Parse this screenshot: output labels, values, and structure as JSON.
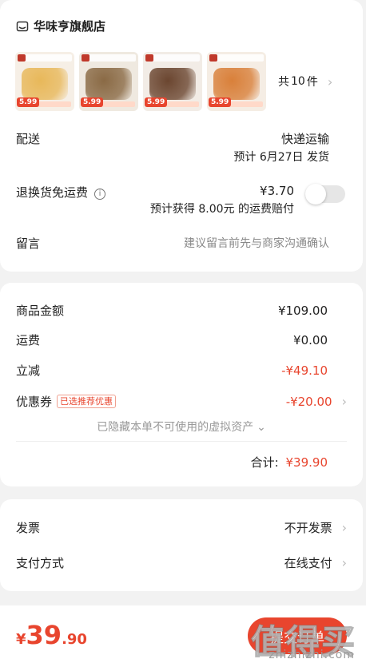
{
  "store": {
    "icon": "store-icon",
    "name": "华味亨旗舰店"
  },
  "items": {
    "thumbs": [
      {
        "price": "5.99",
        "color": "#e8b85a",
        "bg": "#f6efe6"
      },
      {
        "price": "5.99",
        "color": "#8a6a45",
        "bg": "#efe9e0"
      },
      {
        "price": "5.99",
        "color": "#6b4630",
        "bg": "#f2ece6"
      },
      {
        "price": "5.99",
        "color": "#d9803a",
        "bg": "#f5ede4"
      }
    ],
    "count_label": "共",
    "count": "10",
    "count_unit": "件"
  },
  "delivery": {
    "label": "配送",
    "method": "快递运输",
    "eta": "预计 6月27日 发货"
  },
  "return_free": {
    "label": "退换货免运费",
    "price": "¥3.70",
    "note": "预计获得 8.00元 的运费赔付",
    "enabled": false
  },
  "message": {
    "label": "留言",
    "placeholder": "建议留言前先与商家沟通确认"
  },
  "summary": {
    "goods_label": "商品金额",
    "goods_value": "¥109.00",
    "shipping_label": "运费",
    "shipping_value": "¥0.00",
    "discount_label": "立减",
    "discount_value": "-¥49.10",
    "coupon_label": "优惠券",
    "coupon_badge": "已选推荐优惠",
    "coupon_value": "-¥20.00",
    "hidden_assets": "已隐藏本单不可使用的虚拟资产",
    "total_label": "合计:",
    "total_value": "¥39.90"
  },
  "invoice": {
    "label": "发票",
    "value": "不开发票"
  },
  "payment": {
    "label": "支付方式",
    "value": "在线支付"
  },
  "checkout": {
    "currency": "¥",
    "amount_int": "39",
    "amount_dec": ".90",
    "submit_label": "提交订单"
  },
  "watermark": {
    "text": "值得买",
    "url": "zhizhizhi.com"
  },
  "colors": {
    "accent": "#e8452e"
  }
}
